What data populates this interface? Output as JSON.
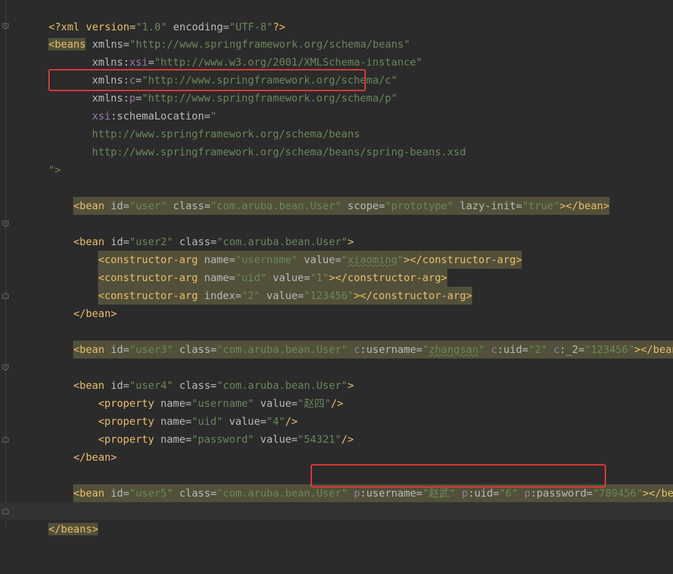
{
  "lines": {
    "l1": {
      "a": "<?xml version=",
      "b": "\"1.0\"",
      "c": " encoding=",
      "d": "\"UTF-8\"",
      "e": "?>"
    },
    "l2": {
      "a": "<beans",
      "b": " xmlns=",
      "c": "\"http://www.springframework.org/schema/beans\""
    },
    "l3": {
      "a": "xmlns:",
      "b": "xsi",
      "c": "=",
      "d": "\"http://www.w3.org/2001/XMLSchema-instance\""
    },
    "l4": {
      "a": "xmlns:",
      "b": "c",
      "c": "=",
      "d": "\"http://www.springframework.org/schema/c\""
    },
    "l5": {
      "a": "xmlns:",
      "b": "p",
      "c": "=",
      "d": "\"http://www.springframework.org/schema/p\""
    },
    "l6": {
      "a": "xsi",
      "b": ":schemaLocation=",
      "c": "\""
    },
    "l7": {
      "a": "http://www.springframework.org/schema/beans"
    },
    "l8": {
      "a": "http://www.springframework.org/schema/beans/spring-beans.xsd"
    },
    "l9": {
      "a": "\">"
    },
    "l11": {
      "a": "<bean",
      "b": " id=",
      "c": "\"user\"",
      "d": " class=",
      "e": "\"com.aruba.bean.User\"",
      "f": " scope=",
      "g": "\"prototype\"",
      "h": " lazy-init=",
      "i": "\"true\"",
      "j": "></bean>"
    },
    "l13": {
      "a": "<bean",
      "b": " id=",
      "c": "\"user2\"",
      "d": " class=",
      "e": "\"com.aruba.bean.User\"",
      "f": ">"
    },
    "l14": {
      "a": "<constructor-arg",
      "b": " name=",
      "c": "\"username\"",
      "d": " value=",
      "e": "\"",
      "f": "xiaoming",
      "g": "\"",
      "h": "></constructor-arg>"
    },
    "l15": {
      "a": "<constructor-arg",
      "b": " name=",
      "c": "\"uid\"",
      "d": " value=",
      "e": "\"1\"",
      "f": "></constructor-arg>"
    },
    "l16": {
      "a": "<constructor-arg",
      "b": " index=",
      "c": "\"2\"",
      "d": " value=",
      "e": "\"123456\"",
      "f": "></constructor-arg>"
    },
    "l17": {
      "a": "</bean>"
    },
    "l19": {
      "a": "<bean",
      "b": " id=",
      "c": "\"user3\"",
      "d": " class=",
      "e": "\"com.aruba.bean.User\"",
      "f": " c",
      "g": ":username=",
      "h": "\"",
      "i": "zhangsan",
      "j": "\"",
      "k": " c",
      "l": ":uid=",
      "m": "\"2\"",
      "n": " c",
      "o": ":_2=",
      "p": "\"123456\"",
      "q": "></bean>"
    },
    "l21": {
      "a": "<bean",
      "b": " id=",
      "c": "\"user4\"",
      "d": " class=",
      "e": "\"com.aruba.bean.User\"",
      "f": ">"
    },
    "l22": {
      "a": "<property",
      "b": " name=",
      "c": "\"username\"",
      "d": " value=",
      "e": "\"赵四\"",
      "f": "/>"
    },
    "l23": {
      "a": "<property",
      "b": " name=",
      "c": "\"uid\"",
      "d": " value=",
      "e": "\"4\"",
      "f": "/>"
    },
    "l24": {
      "a": "<property",
      "b": " name=",
      "c": "\"password\"",
      "d": " value=",
      "e": "\"54321\"",
      "f": "/>"
    },
    "l25": {
      "a": "</bean>"
    },
    "l27": {
      "a": "<bean",
      "b": " id=",
      "c": "\"user5\"",
      "d": " class=",
      "e": "\"com.aruba.bean.User\"",
      "f": " ",
      "g": "p",
      "h": ":username=",
      "i": "\"赵武\"",
      "j": " p",
      "k": ":uid=",
      "l": "\"6\"",
      "m": " p",
      "n": ":password=",
      "o": "\"789456\"",
      "p": "></bean>"
    },
    "l29": {
      "a": "</beans>"
    }
  },
  "colors": {
    "background": "#2b2b2b",
    "tag": "#e8bf6a",
    "attribute": "#bababa",
    "namespace": "#9876aa",
    "value": "#6a8759",
    "tag_highlight": "#52503a",
    "annotation_box": "#e53935"
  }
}
